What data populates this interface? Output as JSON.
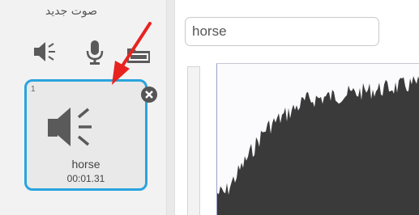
{
  "new_sound": {
    "label": "صوت جديد",
    "buttons": [
      {
        "name": "choose-sound-from-library",
        "icon": "speaker-icon"
      },
      {
        "name": "record-new-sound",
        "icon": "microphone-icon"
      },
      {
        "name": "upload-sound-from-file",
        "icon": "upload-folder-icon"
      }
    ]
  },
  "sound_list": [
    {
      "index": "1",
      "name": "horse",
      "duration": "00:01.31",
      "icon": "speaker-icon",
      "selected": true
    }
  ],
  "editor": {
    "sound_name_value": "horse"
  },
  "annotation": {
    "icon": "red-arrow-icon",
    "color": "#e8231f"
  },
  "colors": {
    "selection": "#29a4de",
    "icon_gray": "#5a5a5a",
    "waveform": "#3a3a3a",
    "sidebar_bg": "#f2f2f2"
  }
}
